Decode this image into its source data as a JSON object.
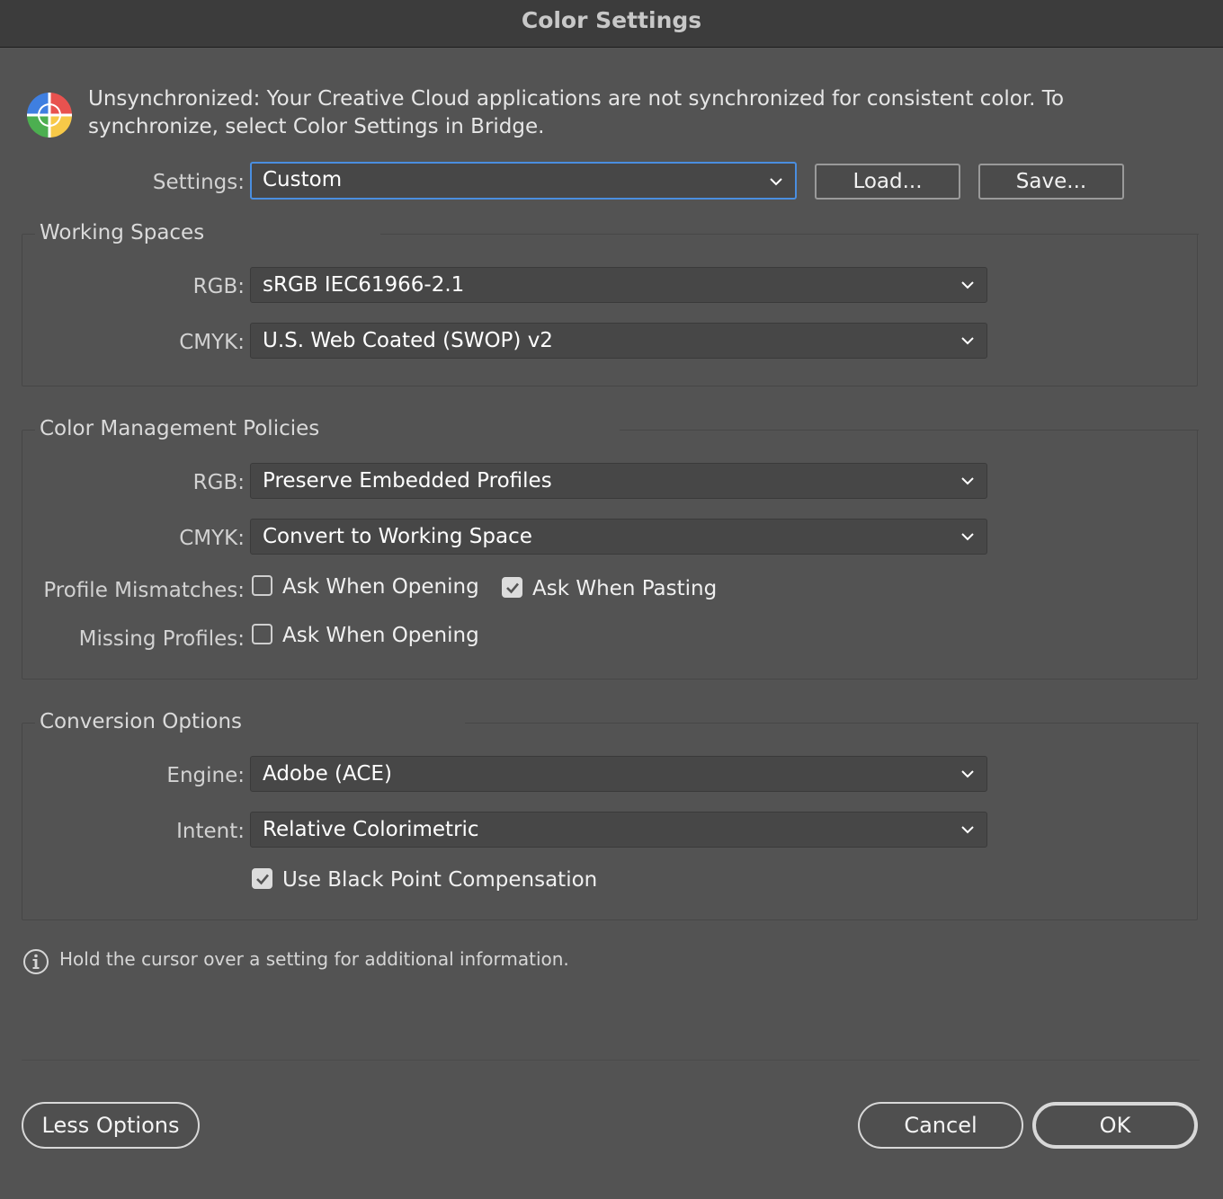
{
  "window": {
    "title": "Color Settings"
  },
  "sync": {
    "icon": "color-sync-icon",
    "message": "Unsynchronized: Your Creative Cloud applications are not synchronized for consistent color. To synchronize, select Color Settings in Bridge."
  },
  "settings": {
    "label": "Settings:",
    "value": "Custom",
    "load_label": "Load...",
    "save_label": "Save..."
  },
  "working_spaces": {
    "title": "Working Spaces",
    "rgb_label": "RGB:",
    "rgb_value": "sRGB IEC61966-2.1",
    "cmyk_label": "CMYK:",
    "cmyk_value": "U.S. Web Coated (SWOP) v2"
  },
  "policies": {
    "title": "Color Management Policies",
    "rgb_label": "RGB:",
    "rgb_value": "Preserve Embedded Profiles",
    "cmyk_label": "CMYK:",
    "cmyk_value": "Convert to Working Space",
    "mismatch_label": "Profile Mismatches:",
    "mismatch_open_label": "Ask When Opening",
    "mismatch_open_checked": false,
    "mismatch_paste_label": "Ask When Pasting",
    "mismatch_paste_checked": true,
    "missing_label": "Missing Profiles:",
    "missing_open_label": "Ask When Opening",
    "missing_open_checked": false
  },
  "conversion": {
    "title": "Conversion Options",
    "engine_label": "Engine:",
    "engine_value": "Adobe (ACE)",
    "intent_label": "Intent:",
    "intent_value": "Relative Colorimetric",
    "bpc_label": "Use Black Point Compensation",
    "bpc_checked": true
  },
  "hint": {
    "icon": "info-icon",
    "text": "Hold the cursor over a setting for additional information."
  },
  "footer": {
    "less_options_label": "Less Options",
    "cancel_label": "Cancel",
    "ok_label": "OK"
  },
  "colors": {
    "background": "#535353",
    "titlebar": "#3c3c3c",
    "focus_ring": "#4a8ee0"
  }
}
